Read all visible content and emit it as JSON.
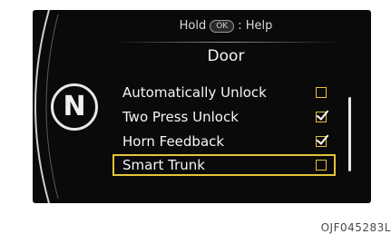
{
  "header": {
    "hint_prefix": "Hold",
    "hint_key": "OK",
    "hint_suffix": ": Help"
  },
  "menu": {
    "title": "Door",
    "items": [
      {
        "label": "Automatically Unlock",
        "checked": false,
        "selected": false
      },
      {
        "label": "Two Press Unlock",
        "checked": true,
        "selected": false
      },
      {
        "label": "Horn Feedback",
        "checked": true,
        "selected": false
      },
      {
        "label": "Smart Trunk",
        "checked": false,
        "selected": true
      }
    ]
  },
  "gear": {
    "label": "N"
  },
  "footer": {
    "code": "OJF045283L"
  },
  "colors": {
    "screen_bg": "#0a0a0a",
    "accent": "#e3c43a",
    "text": "#f5f5f5"
  }
}
